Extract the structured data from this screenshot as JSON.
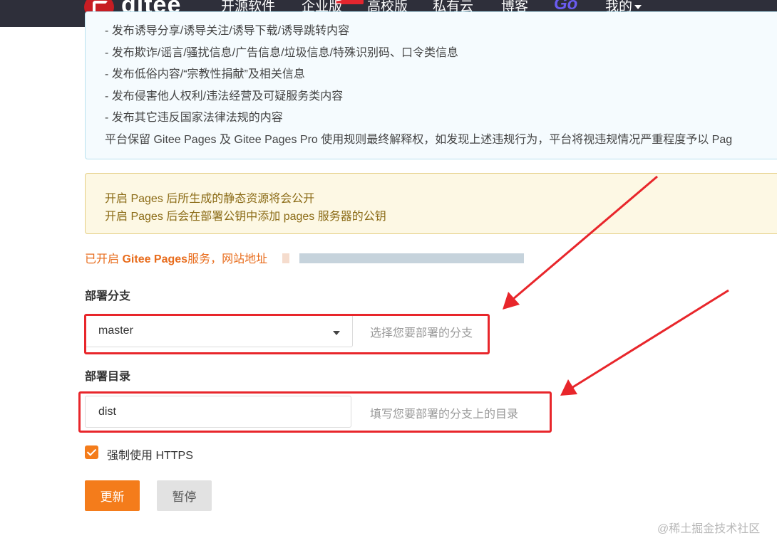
{
  "nav": {
    "logo_text": "gitee",
    "items": [
      "开源软件",
      "企业版",
      "高校版",
      "私有云",
      "博客"
    ],
    "go_label": "Go",
    "me_label": "我的"
  },
  "notice": {
    "lines": [
      "- 发布诱导分享/诱导关注/诱导下载/诱导跳转内容",
      "- 发布欺诈/谣言/骚扰信息/广告信息/垃圾信息/特殊识别码、口令类信息",
      "- 发布低俗内容/“宗教性捐献”及相关信息",
      "- 发布侵害他人权利/违法经营及可疑服务类内容",
      "- 发布其它违反国家法律法规的内容",
      "平台保留 Gitee Pages 及 Gitee Pages Pro 使用规则最终解释权，如发现上述违规行为，平台将视违规情况严重程度予以 Pag"
    ]
  },
  "warning": {
    "lines": [
      "开启 Pages 后所生成的静态资源将会公开",
      "开启 Pages 后会在部署公钥中添加 pages 服务器的公钥"
    ]
  },
  "status": {
    "prefix": "已开启",
    "product": "Gitee Pages",
    "suffix": "服务，网站地址"
  },
  "branch": {
    "label": "部署分支",
    "value": "master",
    "hint": "选择您要部署的分支"
  },
  "directory": {
    "label": "部署目录",
    "value": "dist",
    "hint": "填写您要部署的分支上的目录"
  },
  "https": {
    "checked": true,
    "label": "强制使用 HTTPS"
  },
  "buttons": {
    "update": "更新",
    "pause": "暂停"
  },
  "watermark": "@稀土掘金技术社区",
  "colors": {
    "accent": "#f47c1b",
    "nav_bg": "#2e2f3a",
    "annotation": "#e8262b"
  }
}
